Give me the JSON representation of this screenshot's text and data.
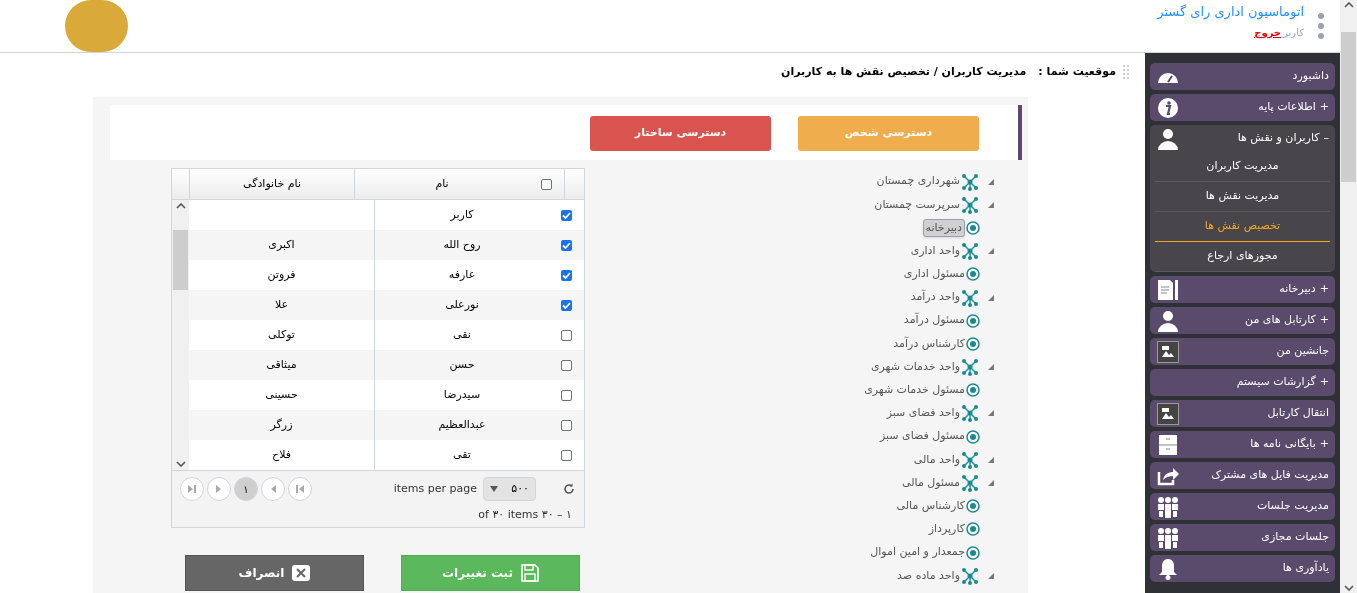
{
  "header": {
    "title": "اتوماسیون اداری رای گستر",
    "user_label": "کاربر",
    "logout": "خروج"
  },
  "breadcrumb": {
    "label": "موقعیت شما :",
    "path": "مدیریت کاربران / تخصیص نقش ها به کاربران"
  },
  "sidebar": {
    "items": [
      {
        "kind": "link",
        "label": "داشبورد"
      },
      {
        "kind": "group",
        "sign": "+",
        "label": "اطلاعات پایه",
        "expanded": false
      },
      {
        "kind": "group",
        "sign": "–",
        "label": "کاربران و نقش ها",
        "expanded": true,
        "children": [
          {
            "label": "مدیریت کاربران",
            "selected": false
          },
          {
            "label": "مدیریت نقش ها",
            "selected": false
          },
          {
            "label": "تخصیص نقش ها",
            "selected": true
          },
          {
            "label": "مجوزهای ارجاع",
            "selected": false
          }
        ]
      },
      {
        "kind": "group",
        "sign": "+",
        "label": "دبیرخانه",
        "expanded": false
      },
      {
        "kind": "group",
        "sign": "+",
        "label": "کارتابل های من",
        "expanded": false
      },
      {
        "kind": "link",
        "label": "جانشین من"
      },
      {
        "kind": "group",
        "sign": "+",
        "label": "گزارشات سیستم",
        "expanded": false
      },
      {
        "kind": "link",
        "label": "انتقال کارتابل"
      },
      {
        "kind": "group",
        "sign": "+",
        "label": "بایگانی نامه ها",
        "expanded": false
      },
      {
        "kind": "link",
        "label": "مدیریت فایل های مشترک"
      },
      {
        "kind": "link",
        "label": "مدیریت جلسات"
      },
      {
        "kind": "link",
        "label": "جلسات مجازی"
      },
      {
        "kind": "link",
        "label": "یادآوری ها"
      }
    ]
  },
  "tabs": [
    {
      "label": "دسترسی شخص",
      "color": "#f0ad4e"
    },
    {
      "label": "دسترسی ساختار",
      "color": "#d9534f"
    }
  ],
  "tree": [
    {
      "kind": "unit",
      "label": "شهرداری چمستان",
      "selected": false
    },
    {
      "kind": "unit",
      "label": "سرپرست چمستان",
      "selected": false
    },
    {
      "kind": "role",
      "label": "دبیرخانه",
      "selected": true
    },
    {
      "kind": "unit",
      "label": "واحد اداری",
      "selected": false
    },
    {
      "kind": "role",
      "label": "مسئول اداری",
      "selected": false
    },
    {
      "kind": "unit",
      "label": "واحد درآمد",
      "selected": false
    },
    {
      "kind": "role",
      "label": "مسئول درآمد",
      "selected": false
    },
    {
      "kind": "role",
      "label": "کارشناس درآمد",
      "selected": false
    },
    {
      "kind": "unit",
      "label": "واحد خدمات شهری",
      "selected": false
    },
    {
      "kind": "role",
      "label": "مسئول خدمات شهری",
      "selected": false
    },
    {
      "kind": "unit",
      "label": "واحد فضای سبز",
      "selected": false
    },
    {
      "kind": "role",
      "label": "مسئول فضای سبز",
      "selected": false
    },
    {
      "kind": "unit",
      "label": "واحد مالی",
      "selected": false
    },
    {
      "kind": "unit",
      "label": "مسئول مالی",
      "selected": false
    },
    {
      "kind": "role",
      "label": "کارشناس مالی",
      "selected": false
    },
    {
      "kind": "role",
      "label": "کارپرداز",
      "selected": false
    },
    {
      "kind": "role",
      "label": "جمعدار و امین اموال",
      "selected": false
    },
    {
      "kind": "unit",
      "label": "واحد ماده صد",
      "selected": false
    }
  ],
  "grid": {
    "select_all": false,
    "columns": [
      "نام",
      "نام خانوادگی"
    ],
    "rows": [
      {
        "checked": true,
        "first": "کاربر"
      },
      {
        "checked": true,
        "first": "روح الله",
        "last": "اکبری"
      },
      {
        "checked": true,
        "first": "عارفه",
        "last": "فروتن"
      },
      {
        "checked": true,
        "first": "نورعلی",
        "last": "علا"
      },
      {
        "checked": false,
        "first": "نقی",
        "last": "توکلی"
      },
      {
        "checked": false,
        "first": "حسن",
        "last": "میثاقی"
      },
      {
        "checked": false,
        "first": "سیدرضا",
        "last": "حسینی"
      },
      {
        "checked": false,
        "first": "عبدالعظیم",
        "last": "زرگر"
      },
      {
        "checked": false,
        "first": "تقی",
        "last": "فلاح"
      }
    ],
    "pager": {
      "page": "۱",
      "per_page_label": "items per page",
      "per_page": "۵۰۰",
      "summary": "of ۳۰ items ۳۰ – ۱"
    }
  },
  "buttons": {
    "save": "ثبت تغییرات",
    "cancel": "انصراف"
  }
}
